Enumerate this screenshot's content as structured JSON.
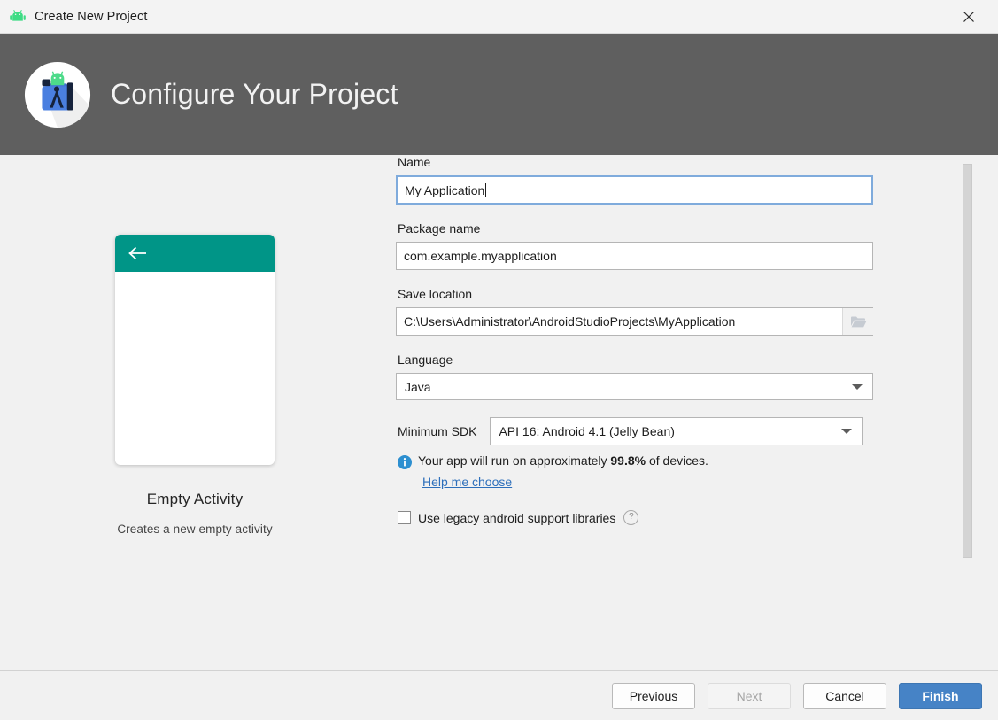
{
  "titlebar": {
    "title": "Create New Project",
    "icon": "android-icon",
    "close_icon": "close-icon"
  },
  "banner": {
    "title": "Configure Your Project",
    "logo": "android-studio-logo",
    "background": "#5f5f5f"
  },
  "preview": {
    "back_icon": "back-arrow-icon",
    "appbar_color": "#009587",
    "title": "Empty Activity",
    "description": "Creates a new empty activity"
  },
  "form": {
    "name": {
      "label": "Name",
      "value": "My Application",
      "focused": true
    },
    "package_name": {
      "label": "Package name",
      "value": "com.example.myapplication"
    },
    "save_location": {
      "label": "Save location",
      "value": "C:\\Users\\Administrator\\AndroidStudioProjects\\MyApplication",
      "browse_icon": "folder-icon"
    },
    "language": {
      "label": "Language",
      "value": "Java",
      "dropdown_icon": "chevron-down-icon"
    },
    "minimum_sdk": {
      "label": "Minimum SDK",
      "value": "API 16: Android 4.1 (Jelly Bean)",
      "dropdown_icon": "chevron-down-icon"
    },
    "device_info": {
      "icon": "info-icon",
      "icon_color": "#2d8fd0",
      "text_before": "Your app will run on approximately ",
      "percent": "99.8%",
      "text_after": " of devices.",
      "link": "Help me choose",
      "link_color": "#2d6fbb"
    },
    "legacy_libraries": {
      "label": "Use legacy android support libraries",
      "checked": false,
      "help_icon": "question-mark-icon",
      "help_glyph": "?"
    }
  },
  "footer": {
    "previous": "Previous",
    "next": "Next",
    "next_disabled": true,
    "cancel": "Cancel",
    "finish": "Finish",
    "finish_color": "#4683c6"
  }
}
